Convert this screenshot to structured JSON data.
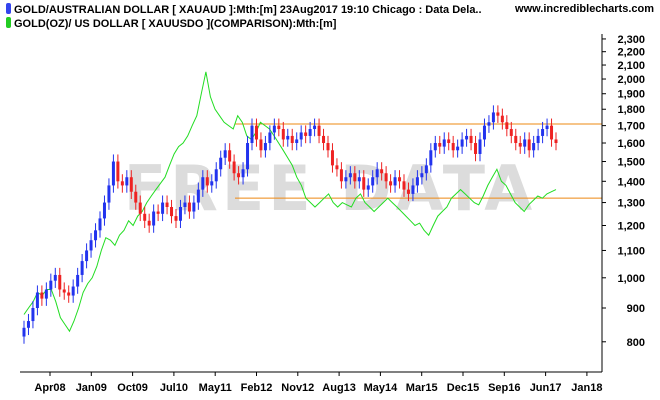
{
  "header": {
    "site": "www.incrediblecharts.com",
    "legend": [
      {
        "label": "GOLD/AUSTRALIAN DOLLAR [ XAUAUD ]:Mth:[m]  23Aug2017 19:10 Chicago : Data Dela..",
        "color": "#3344ee"
      },
      {
        "label": "GOLD(OZ)/ US DOLLAR [ XAUUSDO ](COMPARISON):Mth:[m]",
        "color": "#22cc22"
      }
    ]
  },
  "watermark": "FREE DATA",
  "chart_data": {
    "type": "candlestick-with-comparison-line",
    "x_labels": [
      "Apr08",
      "Jan09",
      "Oct09",
      "Jul10",
      "May11",
      "Feb12",
      "Nov12",
      "Aug13",
      "May14",
      "Mar15",
      "Dec15",
      "Sep16",
      "Jun17",
      "Jan18"
    ],
    "y_ticks": [
      800,
      900,
      1000,
      1100,
      1200,
      1300,
      1400,
      1500,
      1600,
      1700,
      1800,
      1900,
      2000,
      2100,
      2200,
      2300
    ],
    "ylim": [
      720,
      2340
    ],
    "y_scale": "log",
    "horizontal_lines": [
      {
        "value": 1710,
        "color": "#ee8811"
      },
      {
        "value": 1320,
        "color": "#ee8811"
      }
    ],
    "colors": {
      "up": "#2233ee",
      "down": "#ee2222",
      "comparison": "#22dd22",
      "axis": "#000000"
    },
    "candles_close": [
      840,
      860,
      900,
      950,
      930,
      960,
      990,
      1010,
      960,
      950,
      940,
      970,
      1010,
      1060,
      1100,
      1140,
      1180,
      1230,
      1300,
      1380,
      1500,
      1400,
      1380,
      1420,
      1350,
      1300,
      1250,
      1220,
      1200,
      1260,
      1250,
      1300,
      1280,
      1240,
      1220,
      1280,
      1300,
      1260,
      1300,
      1360,
      1420,
      1380,
      1400,
      1460,
      1520,
      1560,
      1500,
      1440,
      1420,
      1460,
      1600,
      1700,
      1620,
      1560,
      1600,
      1660,
      1700,
      1680,
      1620,
      1640,
      1600,
      1620,
      1660,
      1640,
      1680,
      1700,
      1640,
      1600,
      1560,
      1480,
      1460,
      1400,
      1420,
      1440,
      1400,
      1420,
      1360,
      1380,
      1420,
      1460,
      1440,
      1400,
      1380,
      1420,
      1400,
      1360,
      1340,
      1380,
      1420,
      1440,
      1480,
      1560,
      1600,
      1580,
      1620,
      1600,
      1560,
      1580,
      1620,
      1640,
      1600,
      1540,
      1620,
      1700,
      1720,
      1780,
      1760,
      1720,
      1680,
      1640,
      1600,
      1580,
      1620,
      1560,
      1600,
      1640,
      1680,
      1700,
      1620,
      1600
    ],
    "comparison_close": [
      880,
      900,
      920,
      950,
      940,
      960,
      960,
      920,
      870,
      850,
      830,
      860,
      900,
      950,
      980,
      1000,
      1040,
      1100,
      1150,
      1140,
      1120,
      1160,
      1180,
      1220,
      1200,
      1240,
      1260,
      1300,
      1330,
      1360,
      1390,
      1420,
      1480,
      1540,
      1580,
      1600,
      1640,
      1700,
      1760,
      1900,
      2050,
      1880,
      1800,
      1760,
      1720,
      1700,
      1680,
      1760,
      1720,
      1640,
      1620,
      1660,
      1720,
      1700,
      1680,
      1640,
      1600,
      1560,
      1520,
      1480,
      1420,
      1380,
      1320,
      1300,
      1280,
      1300,
      1320,
      1340,
      1300,
      1280,
      1300,
      1290,
      1280,
      1320,
      1340,
      1300,
      1280,
      1260,
      1280,
      1300,
      1320,
      1300,
      1280,
      1260,
      1240,
      1220,
      1200,
      1210,
      1180,
      1160,
      1200,
      1240,
      1260,
      1280,
      1320,
      1340,
      1360,
      1340,
      1320,
      1300,
      1290,
      1330,
      1380,
      1420,
      1460,
      1400,
      1380,
      1340,
      1300,
      1280,
      1260,
      1290,
      1310,
      1330,
      1320,
      1340,
      1350,
      1360
    ]
  }
}
